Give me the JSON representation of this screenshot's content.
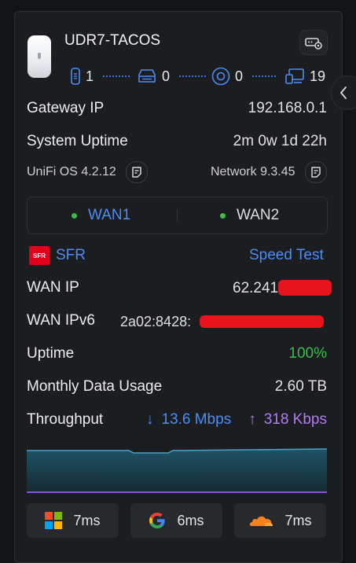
{
  "device": {
    "name": "UDR7-TACOS",
    "stats": {
      "clients_wired_a": "1",
      "clients_wired_b": "0",
      "clients_wireless": "0",
      "clients_total": "19"
    }
  },
  "info": {
    "gateway_ip_label": "Gateway IP",
    "gateway_ip": "192.168.0.1",
    "uptime_label": "System Uptime",
    "uptime": "2m 0w 1d 22h",
    "os_version": "UniFi OS 4.2.12",
    "network_version": "Network 9.3.45"
  },
  "wan_tabs": [
    {
      "label": "WAN1"
    },
    {
      "label": "WAN2"
    }
  ],
  "isp": {
    "name": "SFR",
    "logo_text": "SFR",
    "speed_test": "Speed Test",
    "wan_ip_label": "WAN IP",
    "wan_ip": "62.241",
    "wan_ipv6_label": "WAN IPv6",
    "wan_ipv6": "2a02:8428:",
    "uptime_label": "Uptime",
    "uptime": "100%",
    "data_usage_label": "Monthly Data Usage",
    "data_usage": "2.60 TB",
    "throughput_label": "Throughput",
    "download": "13.6 Mbps",
    "upload": "318 Kbps"
  },
  "latency": [
    {
      "service": "microsoft-logo",
      "value": "7ms"
    },
    {
      "service": "google-logo",
      "value": "6ms"
    },
    {
      "service": "cloudflare-logo",
      "value": "7ms"
    }
  ],
  "colors": {
    "accent": "#4c8cf5",
    "ok": "#3dbb4c",
    "upload": "#b07cf0",
    "panel": "#1c1d20"
  }
}
